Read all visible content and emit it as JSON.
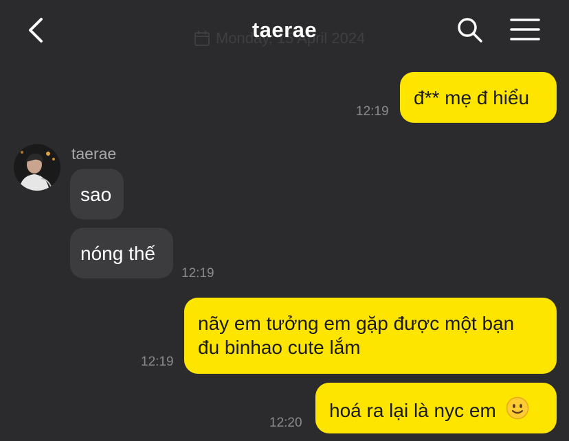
{
  "header": {
    "title": "taerae",
    "date_overlay": "Monday, 15 April 2024"
  },
  "icons": {
    "back": "chevron-left-icon",
    "search": "search-icon",
    "menu": "hamburger-menu-icon",
    "calendar": "calendar-icon",
    "emoji": "slightly-smiling-face-icon"
  },
  "colors": {
    "background": "#2b2b2d",
    "outgoing_bubble": "#fee500",
    "incoming_bubble": "#3c3c3f",
    "timestamp": "#8a8a8e"
  },
  "messages": [
    {
      "direction": "out",
      "text": "đ** mẹ đ hiểu",
      "time": "12:19"
    },
    {
      "direction": "in",
      "sender": "taerae",
      "text": "sao"
    },
    {
      "direction": "in",
      "text": "nóng thế",
      "time": "12:19"
    },
    {
      "direction": "out",
      "lines": [
        "nãy em tưởng em gặp được một bạn",
        "đu binhao cute lắm"
      ],
      "time": "12:19"
    },
    {
      "direction": "out",
      "text": "hoá ra lại là nyc em",
      "time": "12:20",
      "emoji": "🙂"
    }
  ]
}
